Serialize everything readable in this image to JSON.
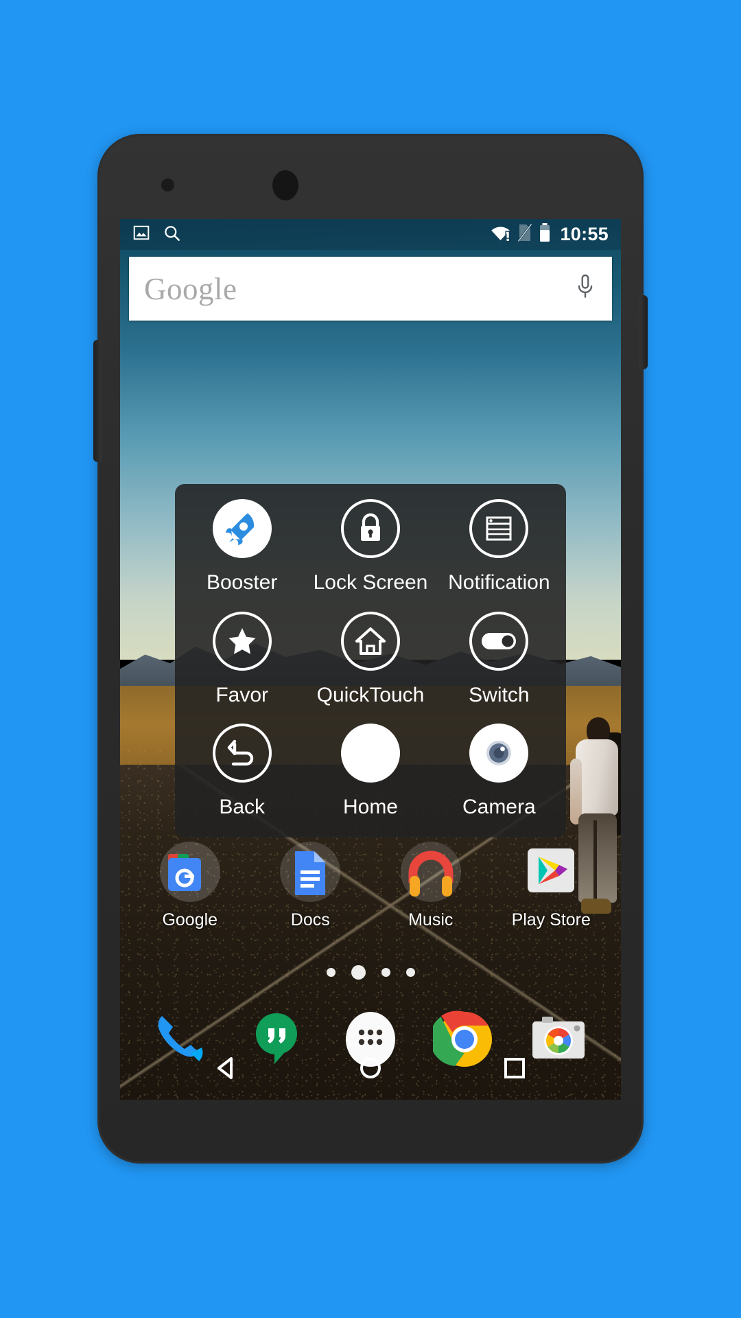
{
  "background": {
    "color": "#2196f3"
  },
  "device": {
    "body_color": "#2f2f2f",
    "sensor": "proximity-sensor",
    "camera": "front-camera",
    "volume": "volume-rocker",
    "power": "power-button"
  },
  "status_bar": {
    "left_icons": [
      {
        "name": "image-icon",
        "glyph": "image"
      },
      {
        "name": "search-icon",
        "glyph": "search"
      }
    ],
    "right_icons": [
      {
        "name": "wifi-alert-icon",
        "glyph": "wifi-no-internet"
      },
      {
        "name": "no-sim-icon",
        "glyph": "sim-crossed"
      },
      {
        "name": "battery-icon",
        "glyph": "battery"
      }
    ],
    "time": "10:55"
  },
  "search_widget": {
    "logo_text": "Google",
    "mic_icon": "microphone-icon"
  },
  "quick_panel": {
    "items": [
      {
        "label": "Booster",
        "icon": "rocket-icon",
        "style": "solid-white"
      },
      {
        "label": "Lock Screen",
        "icon": "lock-icon",
        "style": "ring"
      },
      {
        "label": "Notification",
        "icon": "notification-list-icon",
        "style": "ring"
      },
      {
        "label": "Favor",
        "icon": "star-icon",
        "style": "ring"
      },
      {
        "label": "QuickTouch",
        "icon": "home-house-icon",
        "style": "ring"
      },
      {
        "label": "Switch",
        "icon": "toggle-switch-icon",
        "style": "ring"
      },
      {
        "label": "Back",
        "icon": "back-arrow-icon",
        "style": "ring"
      },
      {
        "label": "Home",
        "icon": "home-circle-icon",
        "style": "solid-white"
      },
      {
        "label": "Camera",
        "icon": "camera-lens-icon",
        "style": "solid-white"
      }
    ],
    "accent_color": "#2b8ce0",
    "background_color": "rgba(34,34,34,0.88)"
  },
  "home_apps": [
    {
      "label": "Google",
      "icon": "google-folder-icon"
    },
    {
      "label": "Docs",
      "icon": "google-docs-icon"
    },
    {
      "label": "Music",
      "icon": "google-music-icon"
    },
    {
      "label": "Play Store",
      "icon": "play-store-icon"
    }
  ],
  "page_indicator": {
    "count": 4,
    "active_index": 1
  },
  "dock": [
    {
      "label": "Phone",
      "icon": "phone-icon"
    },
    {
      "label": "Hangouts",
      "icon": "hangouts-icon"
    },
    {
      "label": "Apps",
      "icon": "app-drawer-icon"
    },
    {
      "label": "Chrome",
      "icon": "chrome-icon"
    },
    {
      "label": "Camera",
      "icon": "camera-app-icon"
    }
  ],
  "nav_bar": [
    {
      "label": "Back",
      "icon": "nav-back-triangle-icon"
    },
    {
      "label": "Home",
      "icon": "nav-home-circle-icon"
    },
    {
      "label": "Recents",
      "icon": "nav-recents-square-icon"
    }
  ]
}
